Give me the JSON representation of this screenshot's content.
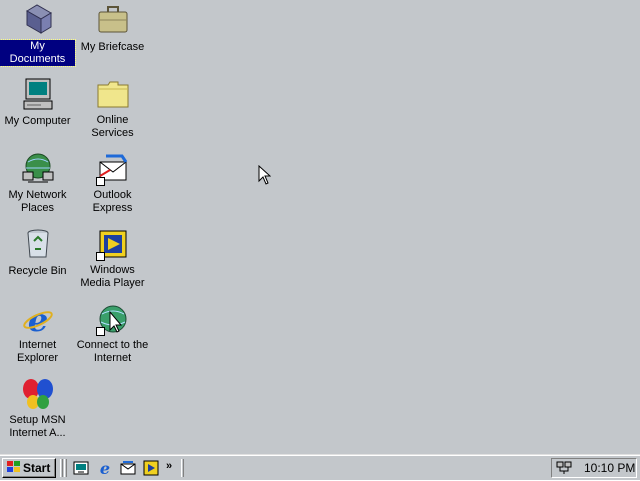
{
  "desktop": {
    "background": "#c3c7cb",
    "icons": [
      {
        "label": "My Documents",
        "icon": "my-documents-icon",
        "selected": true
      },
      {
        "label": "My Briefcase",
        "icon": "briefcase-icon"
      },
      {
        "label": "My Computer",
        "icon": "my-computer-icon"
      },
      {
        "label": "Online\nServices",
        "icon": "folder-icon"
      },
      {
        "label": "My Network\nPlaces",
        "icon": "network-places-icon"
      },
      {
        "label": "Outlook\nExpress",
        "icon": "outlook-express-icon"
      },
      {
        "label": "Recycle Bin",
        "icon": "recycle-bin-icon"
      },
      {
        "label": "Windows\nMedia Player",
        "icon": "media-player-icon"
      },
      {
        "label": "Internet\nExplorer",
        "icon": "internet-explorer-icon"
      },
      {
        "label": "Connect to the\nInternet",
        "icon": "connect-internet-icon"
      },
      {
        "label": "Setup MSN\nInternet A...",
        "icon": "msn-butterfly-icon"
      }
    ]
  },
  "taskbar": {
    "start_label": "Start",
    "quick_launch": [
      {
        "icon": "show-desktop-icon"
      },
      {
        "icon": "internet-explorer-icon"
      },
      {
        "icon": "outlook-express-icon"
      },
      {
        "icon": "media-player-icon"
      }
    ],
    "chevron": "»",
    "tray": {
      "network_icon": "network-tray-icon",
      "clock": "10:10 PM"
    }
  }
}
